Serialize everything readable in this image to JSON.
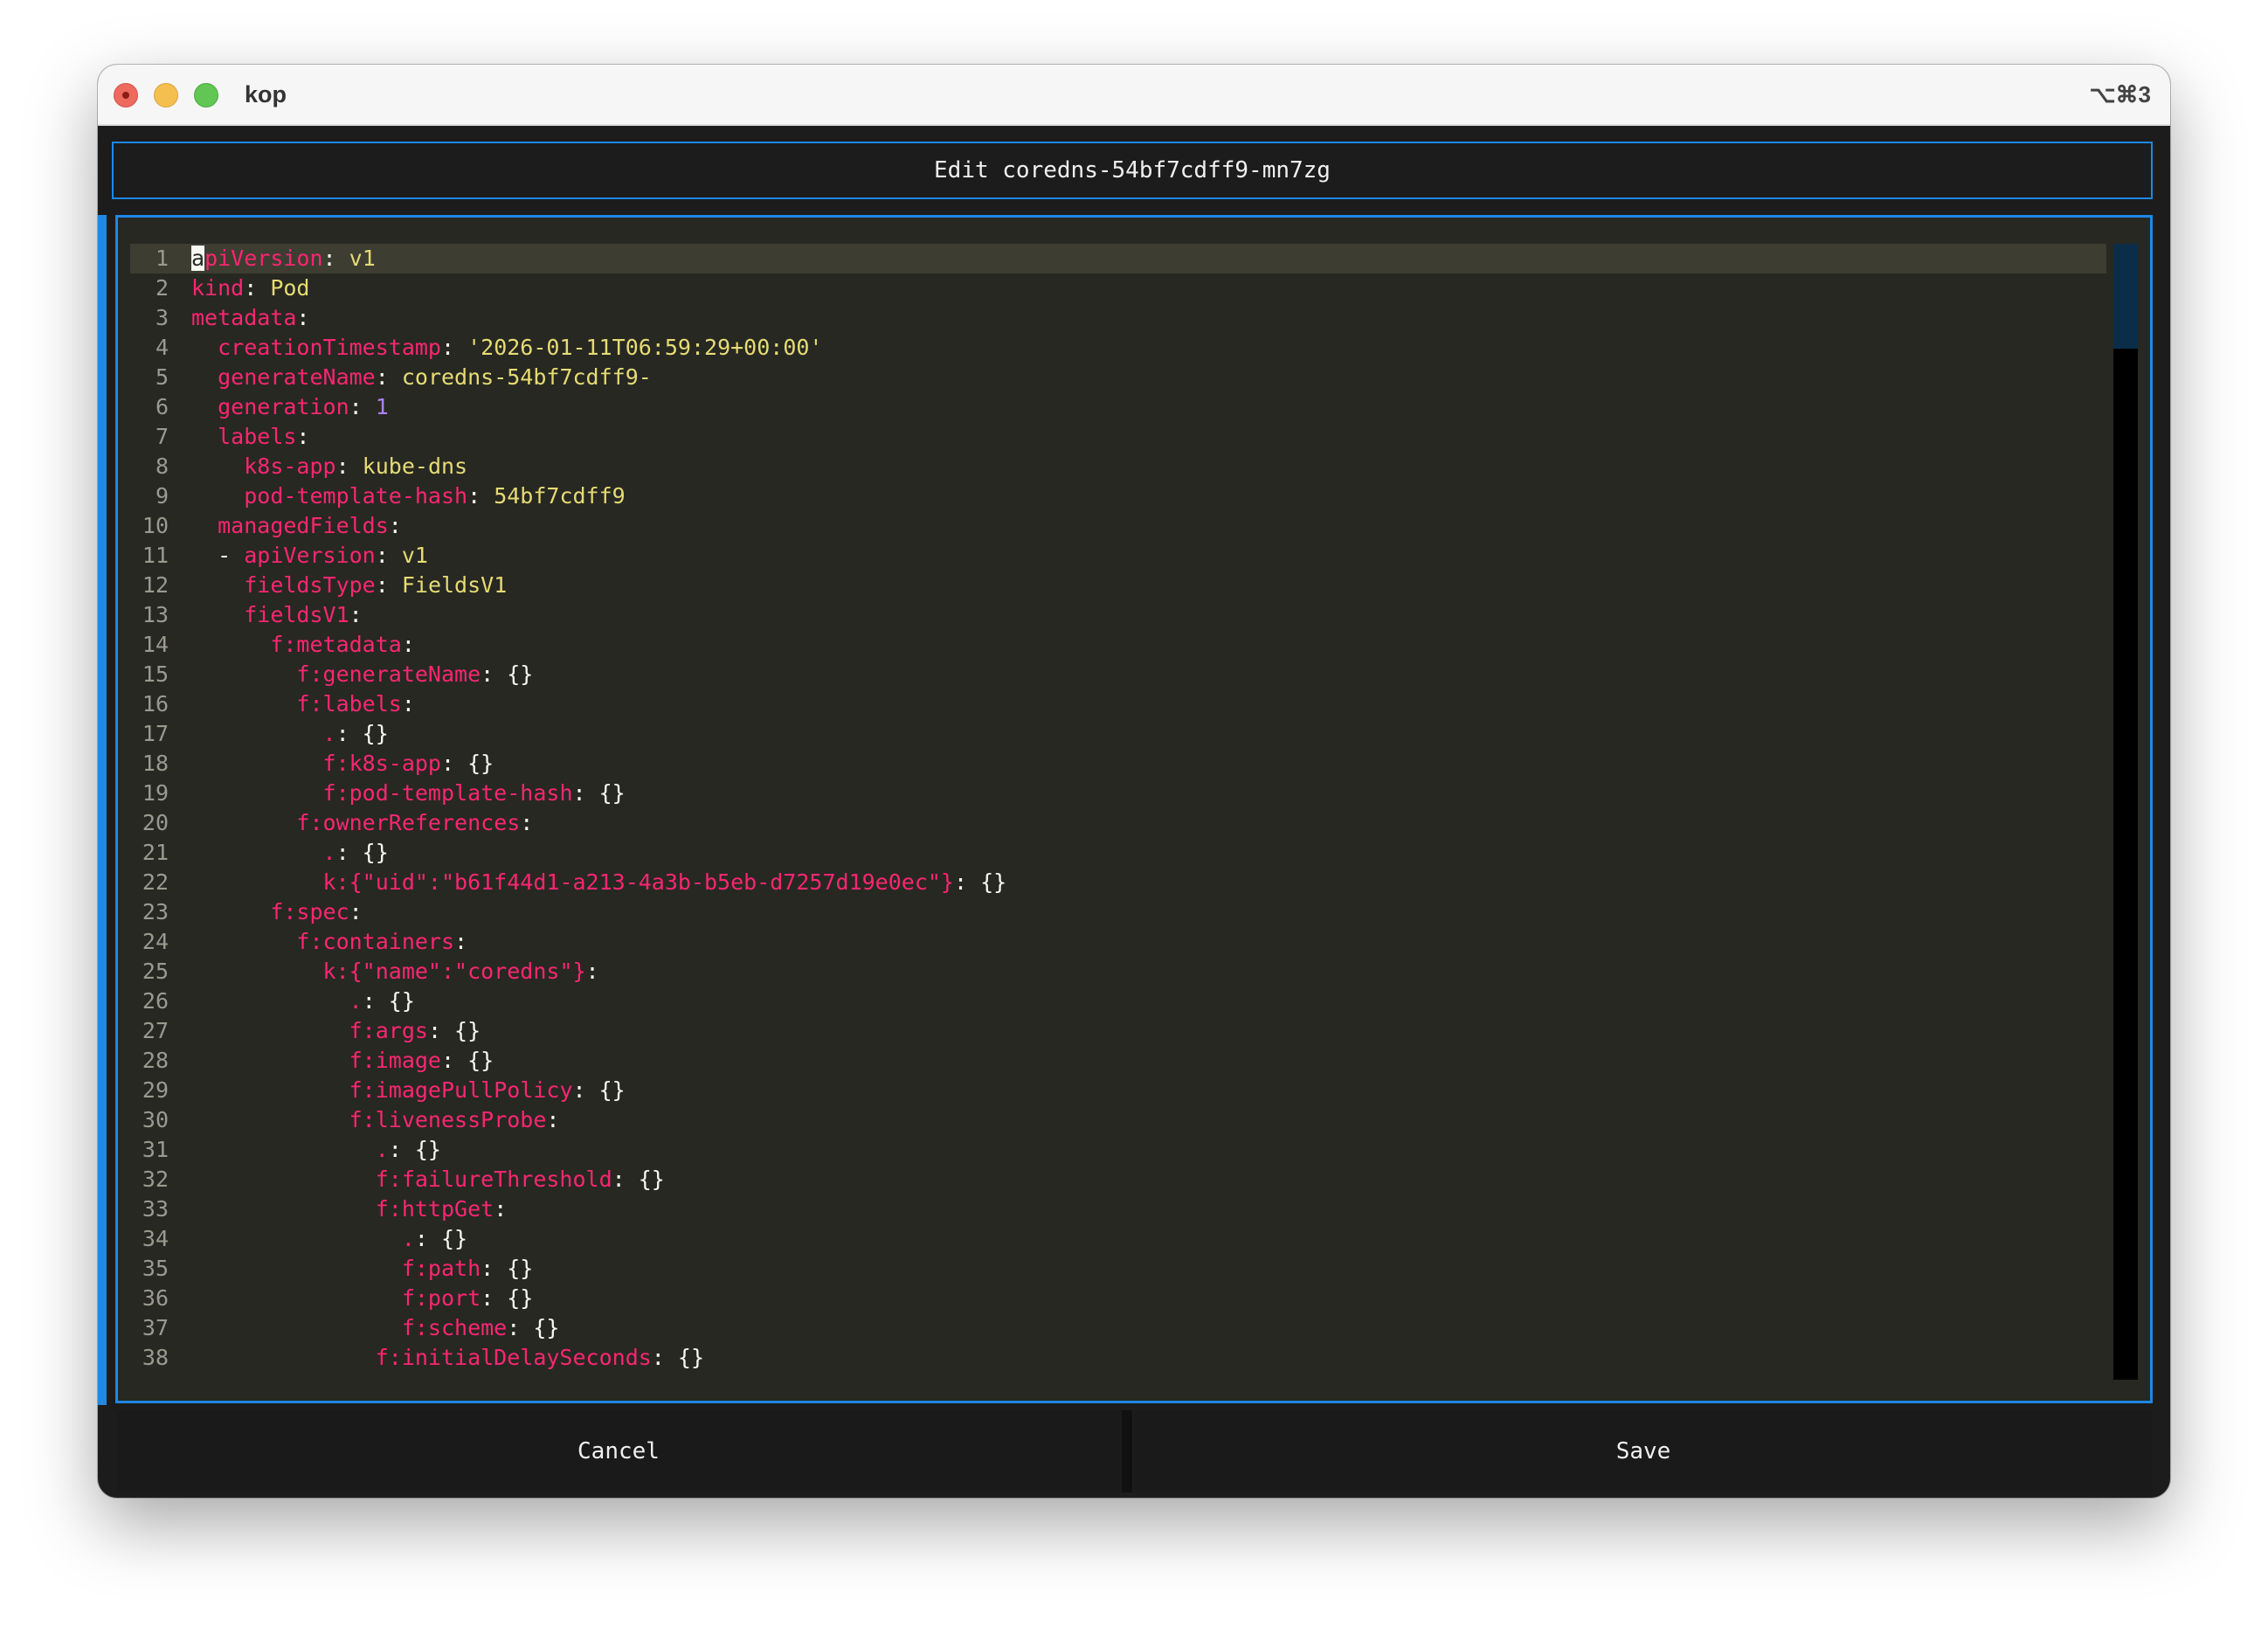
{
  "window": {
    "app_title": "kop",
    "shortcut": "⌥⌘3"
  },
  "header": {
    "title": "Edit coredns-54bf7cdff9-mn7zg"
  },
  "editor": {
    "lines": [
      {
        "n": "1",
        "parts": [
          {
            "t": "a",
            "c": "cursor"
          },
          {
            "t": "piVersion",
            "c": "k"
          },
          {
            "t": ": ",
            "c": "p"
          },
          {
            "t": "v1",
            "c": "v"
          }
        ]
      },
      {
        "n": "2",
        "parts": [
          {
            "t": "kind",
            "c": "k"
          },
          {
            "t": ": ",
            "c": "p"
          },
          {
            "t": "Pod",
            "c": "v"
          }
        ]
      },
      {
        "n": "3",
        "parts": [
          {
            "t": "metadata",
            "c": "k"
          },
          {
            "t": ":",
            "c": "p"
          }
        ]
      },
      {
        "n": "4",
        "parts": [
          {
            "t": "  ",
            "c": "p"
          },
          {
            "t": "creationTimestamp",
            "c": "k"
          },
          {
            "t": ": ",
            "c": "p"
          },
          {
            "t": "'2026-01-11T06:59:29+00:00'",
            "c": "v"
          }
        ]
      },
      {
        "n": "5",
        "parts": [
          {
            "t": "  ",
            "c": "p"
          },
          {
            "t": "generateName",
            "c": "k"
          },
          {
            "t": ": ",
            "c": "p"
          },
          {
            "t": "coredns-54bf7cdff9-",
            "c": "v"
          }
        ]
      },
      {
        "n": "6",
        "parts": [
          {
            "t": "  ",
            "c": "p"
          },
          {
            "t": "generation",
            "c": "k"
          },
          {
            "t": ": ",
            "c": "p"
          },
          {
            "t": "1",
            "c": "n"
          }
        ]
      },
      {
        "n": "7",
        "parts": [
          {
            "t": "  ",
            "c": "p"
          },
          {
            "t": "labels",
            "c": "k"
          },
          {
            "t": ":",
            "c": "p"
          }
        ]
      },
      {
        "n": "8",
        "parts": [
          {
            "t": "    ",
            "c": "p"
          },
          {
            "t": "k8s-app",
            "c": "k"
          },
          {
            "t": ": ",
            "c": "p"
          },
          {
            "t": "kube-dns",
            "c": "v"
          }
        ]
      },
      {
        "n": "9",
        "parts": [
          {
            "t": "    ",
            "c": "p"
          },
          {
            "t": "pod-template-hash",
            "c": "k"
          },
          {
            "t": ": ",
            "c": "p"
          },
          {
            "t": "54bf7cdff9",
            "c": "v"
          }
        ]
      },
      {
        "n": "10",
        "parts": [
          {
            "t": "  ",
            "c": "p"
          },
          {
            "t": "managedFields",
            "c": "k"
          },
          {
            "t": ":",
            "c": "p"
          }
        ]
      },
      {
        "n": "11",
        "parts": [
          {
            "t": "  - ",
            "c": "p"
          },
          {
            "t": "apiVersion",
            "c": "k"
          },
          {
            "t": ": ",
            "c": "p"
          },
          {
            "t": "v1",
            "c": "v"
          }
        ]
      },
      {
        "n": "12",
        "parts": [
          {
            "t": "    ",
            "c": "p"
          },
          {
            "t": "fieldsType",
            "c": "k"
          },
          {
            "t": ": ",
            "c": "p"
          },
          {
            "t": "FieldsV1",
            "c": "v"
          }
        ]
      },
      {
        "n": "13",
        "parts": [
          {
            "t": "    ",
            "c": "p"
          },
          {
            "t": "fieldsV1",
            "c": "k"
          },
          {
            "t": ":",
            "c": "p"
          }
        ]
      },
      {
        "n": "14",
        "parts": [
          {
            "t": "      ",
            "c": "p"
          },
          {
            "t": "f:metadata",
            "c": "k"
          },
          {
            "t": ":",
            "c": "p"
          }
        ]
      },
      {
        "n": "15",
        "parts": [
          {
            "t": "        ",
            "c": "p"
          },
          {
            "t": "f:generateName",
            "c": "k"
          },
          {
            "t": ": {}",
            "c": "p"
          }
        ]
      },
      {
        "n": "16",
        "parts": [
          {
            "t": "        ",
            "c": "p"
          },
          {
            "t": "f:labels",
            "c": "k"
          },
          {
            "t": ":",
            "c": "p"
          }
        ]
      },
      {
        "n": "17",
        "parts": [
          {
            "t": "          ",
            "c": "p"
          },
          {
            "t": ".",
            "c": "k"
          },
          {
            "t": ": {}",
            "c": "p"
          }
        ]
      },
      {
        "n": "18",
        "parts": [
          {
            "t": "          ",
            "c": "p"
          },
          {
            "t": "f:k8s-app",
            "c": "k"
          },
          {
            "t": ": {}",
            "c": "p"
          }
        ]
      },
      {
        "n": "19",
        "parts": [
          {
            "t": "          ",
            "c": "p"
          },
          {
            "t": "f:pod-template-hash",
            "c": "k"
          },
          {
            "t": ": {}",
            "c": "p"
          }
        ]
      },
      {
        "n": "20",
        "parts": [
          {
            "t": "        ",
            "c": "p"
          },
          {
            "t": "f:ownerReferences",
            "c": "k"
          },
          {
            "t": ":",
            "c": "p"
          }
        ]
      },
      {
        "n": "21",
        "parts": [
          {
            "t": "          ",
            "c": "p"
          },
          {
            "t": ".",
            "c": "k"
          },
          {
            "t": ": {}",
            "c": "p"
          }
        ]
      },
      {
        "n": "22",
        "parts": [
          {
            "t": "          ",
            "c": "p"
          },
          {
            "t": "k:{\"uid\":\"b61f44d1-a213-4a3b-b5eb-d7257d19e0ec\"}",
            "c": "k"
          },
          {
            "t": ": {}",
            "c": "p"
          }
        ]
      },
      {
        "n": "23",
        "parts": [
          {
            "t": "      ",
            "c": "p"
          },
          {
            "t": "f:spec",
            "c": "k"
          },
          {
            "t": ":",
            "c": "p"
          }
        ]
      },
      {
        "n": "24",
        "parts": [
          {
            "t": "        ",
            "c": "p"
          },
          {
            "t": "f:containers",
            "c": "k"
          },
          {
            "t": ":",
            "c": "p"
          }
        ]
      },
      {
        "n": "25",
        "parts": [
          {
            "t": "          ",
            "c": "p"
          },
          {
            "t": "k:{\"name\":\"coredns\"}",
            "c": "k"
          },
          {
            "t": ":",
            "c": "p"
          }
        ]
      },
      {
        "n": "26",
        "parts": [
          {
            "t": "            ",
            "c": "p"
          },
          {
            "t": ".",
            "c": "k"
          },
          {
            "t": ": {}",
            "c": "p"
          }
        ]
      },
      {
        "n": "27",
        "parts": [
          {
            "t": "            ",
            "c": "p"
          },
          {
            "t": "f:args",
            "c": "k"
          },
          {
            "t": ": {}",
            "c": "p"
          }
        ]
      },
      {
        "n": "28",
        "parts": [
          {
            "t": "            ",
            "c": "p"
          },
          {
            "t": "f:image",
            "c": "k"
          },
          {
            "t": ": {}",
            "c": "p"
          }
        ]
      },
      {
        "n": "29",
        "parts": [
          {
            "t": "            ",
            "c": "p"
          },
          {
            "t": "f:imagePullPolicy",
            "c": "k"
          },
          {
            "t": ": {}",
            "c": "p"
          }
        ]
      },
      {
        "n": "30",
        "parts": [
          {
            "t": "            ",
            "c": "p"
          },
          {
            "t": "f:livenessProbe",
            "c": "k"
          },
          {
            "t": ":",
            "c": "p"
          }
        ]
      },
      {
        "n": "31",
        "parts": [
          {
            "t": "              ",
            "c": "p"
          },
          {
            "t": ".",
            "c": "k"
          },
          {
            "t": ": {}",
            "c": "p"
          }
        ]
      },
      {
        "n": "32",
        "parts": [
          {
            "t": "              ",
            "c": "p"
          },
          {
            "t": "f:failureThreshold",
            "c": "k"
          },
          {
            "t": ": {}",
            "c": "p"
          }
        ]
      },
      {
        "n": "33",
        "parts": [
          {
            "t": "              ",
            "c": "p"
          },
          {
            "t": "f:httpGet",
            "c": "k"
          },
          {
            "t": ":",
            "c": "p"
          }
        ]
      },
      {
        "n": "34",
        "parts": [
          {
            "t": "                ",
            "c": "p"
          },
          {
            "t": ".",
            "c": "k"
          },
          {
            "t": ": {}",
            "c": "p"
          }
        ]
      },
      {
        "n": "35",
        "parts": [
          {
            "t": "                ",
            "c": "p"
          },
          {
            "t": "f:path",
            "c": "k"
          },
          {
            "t": ": {}",
            "c": "p"
          }
        ]
      },
      {
        "n": "36",
        "parts": [
          {
            "t": "                ",
            "c": "p"
          },
          {
            "t": "f:port",
            "c": "k"
          },
          {
            "t": ": {}",
            "c": "p"
          }
        ]
      },
      {
        "n": "37",
        "parts": [
          {
            "t": "                ",
            "c": "p"
          },
          {
            "t": "f:scheme",
            "c": "k"
          },
          {
            "t": ": {}",
            "c": "p"
          }
        ]
      },
      {
        "n": "38",
        "parts": [
          {
            "t": "              ",
            "c": "p"
          },
          {
            "t": "f:initialDelaySeconds",
            "c": "k"
          },
          {
            "t": ": {}",
            "c": "p"
          }
        ]
      }
    ],
    "active_line": 1
  },
  "footer": {
    "cancel_label": "Cancel",
    "save_label": "Save"
  },
  "colors": {
    "accent": "#1e88e5",
    "editor_bg": "#272822",
    "key": "#f92672",
    "string": "#e6db74",
    "number": "#ae81ff"
  }
}
